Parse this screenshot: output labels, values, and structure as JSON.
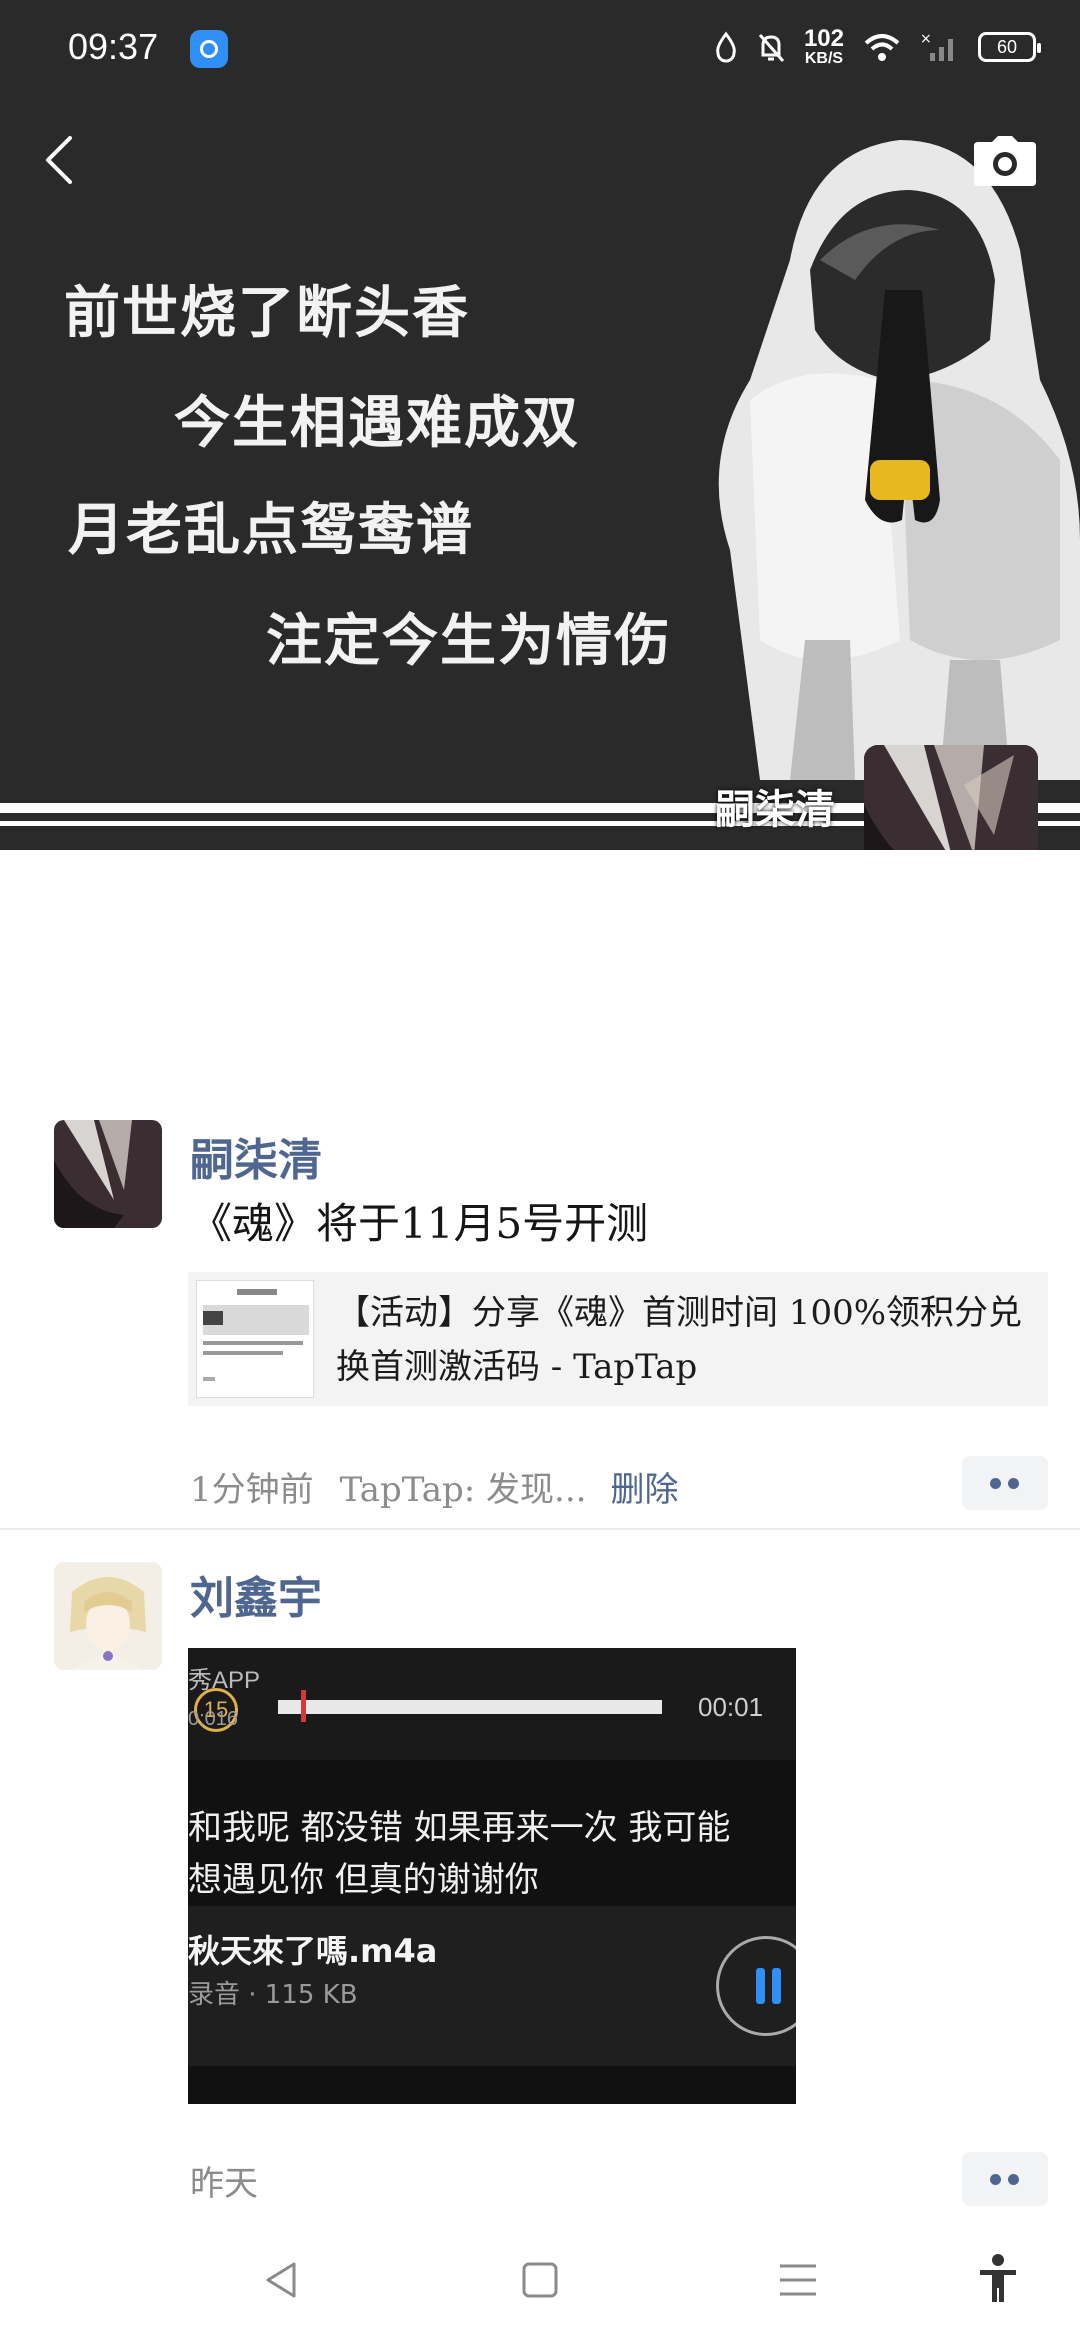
{
  "status_bar": {
    "time": "09:37",
    "net_speed_value": "102",
    "net_speed_unit": "KB/S",
    "battery": "60"
  },
  "cover": {
    "poem_lines": [
      "前世烧了断头香",
      "今生相遇难成双",
      "月老乱点鸳鸯谱",
      "注定今生为情伤"
    ],
    "user_name": "嗣柒清"
  },
  "posts": [
    {
      "author": "嗣柒清",
      "text": "《魂》将于11月5号开测",
      "link_title": "【活动】分享《魂》首测时间 100%领积分兑换首测激活码 - TapTap",
      "time": "1分钟前",
      "source": "TapTap: 发现...",
      "delete_label": "删除"
    },
    {
      "author": "刘鑫宇",
      "video": {
        "app_label": "秀APP",
        "badge": "15",
        "sub_time": "0:016",
        "current_time": "00:01",
        "progress": 0.06,
        "lyric_1": "和我呢  都没错  如果再来一次  我可能",
        "lyric_2": "想遇见你  但真的谢谢你",
        "file_name": "秋天來了嗎.m4a",
        "file_info": "录音 · 115 KB"
      },
      "time": "昨天"
    }
  ],
  "icons": {
    "back": "chevron-left-icon",
    "camera": "camera-icon",
    "more": "more-dots-icon",
    "nav_back": "triangle-back-icon",
    "nav_home": "square-home-icon",
    "nav_menu": "hamburger-menu-icon",
    "accessibility": "accessibility-icon"
  },
  "colors": {
    "name_blue": "#4e6690",
    "cover_bg": "#2a2a2a",
    "accent_blue": "#2f8ff6"
  }
}
